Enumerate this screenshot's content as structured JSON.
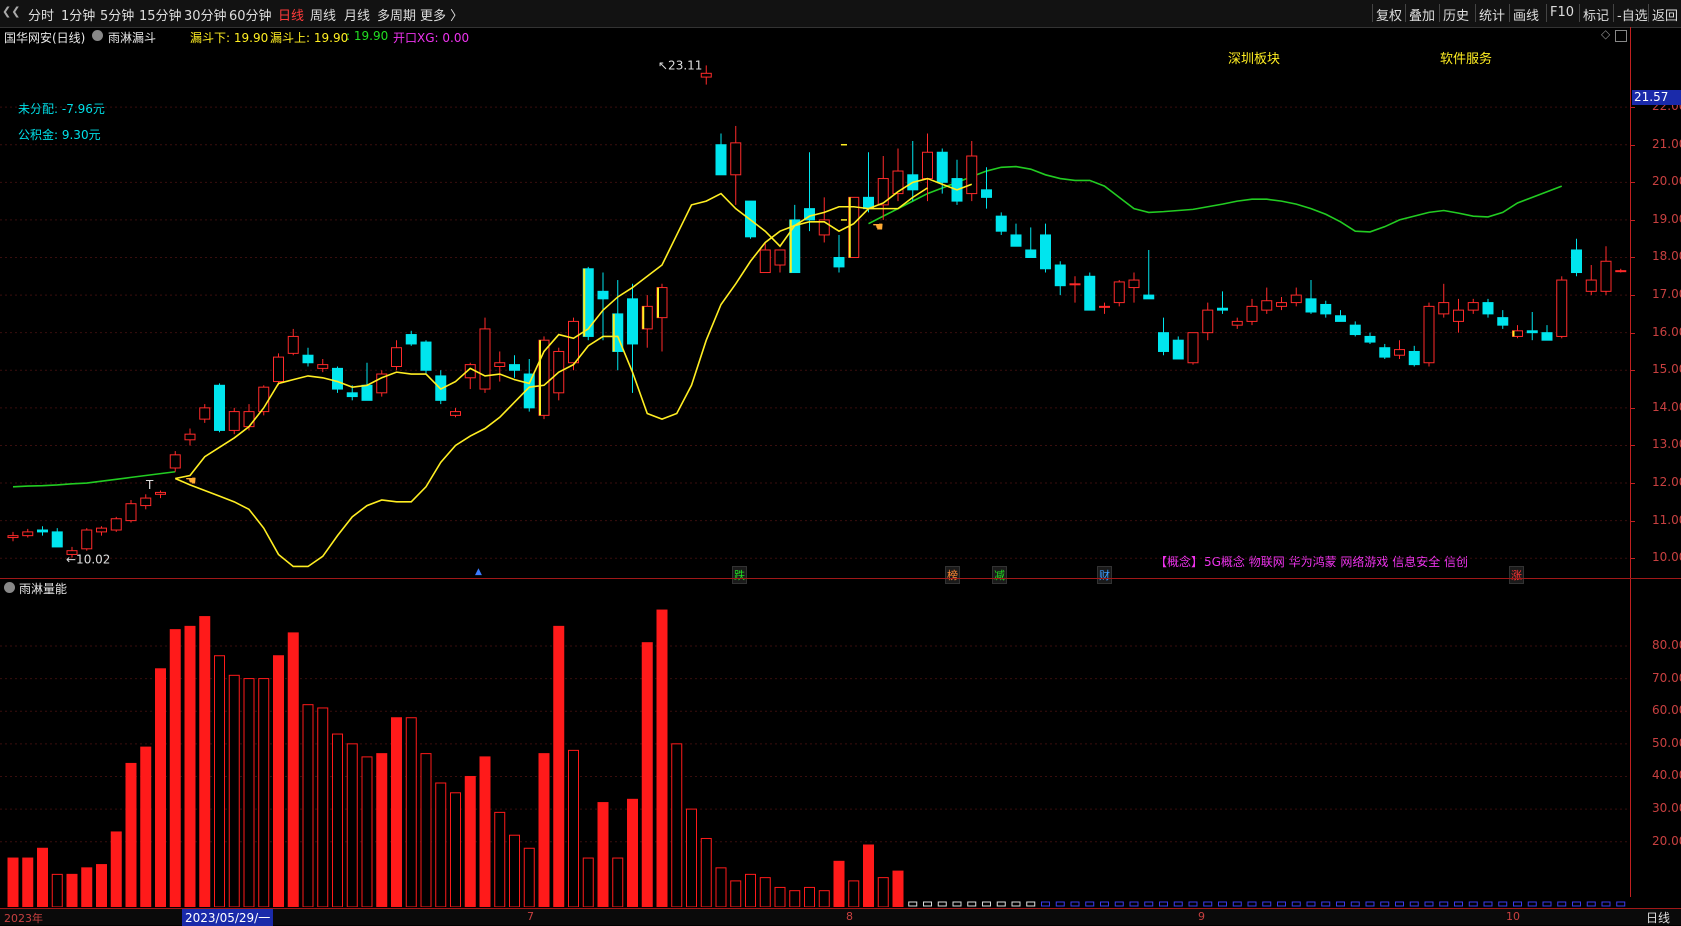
{
  "toolbar": {
    "periods": [
      "分时",
      "1分钟",
      "5分钟",
      "15分钟",
      "30分钟",
      "60分钟",
      "日线",
      "周线",
      "月线",
      "多周期",
      "更多 〉"
    ],
    "active": "日线",
    "right": [
      "复权",
      "叠加",
      "历史",
      "统计",
      "画线",
      "F10",
      "标记",
      "-自选",
      "返回"
    ]
  },
  "info": {
    "stock": "国华网安(日线)",
    "indicator": "雨淋漏斗",
    "f1": "漏斗下: 19.90",
    "f2": "漏斗上: 19.90",
    "f3": ": 19.90",
    "f4": "开口XG: 0.00"
  },
  "overlay": {
    "unallocated": "未分配: -7.96元",
    "reserve": "公积金: 9.30元",
    "sector1": "深圳板块",
    "sector2": "软件服务",
    "high_label": "23.11",
    "low_label": "10.02",
    "concept_prefix": "【概念】",
    "concept_list": "5G概念 物联网 华为鸿蒙 网络游戏 信息安全 信创",
    "markers": [
      "跌",
      "榜",
      "减",
      "财",
      "涨"
    ]
  },
  "price_axis": {
    "current": "21.57",
    "ticks": [
      "22.00",
      "21.00",
      "20.00",
      "19.00",
      "18.00",
      "17.00",
      "16.00",
      "15.00",
      "14.00",
      "13.00",
      "12.00",
      "11.00",
      "10.00"
    ]
  },
  "volume_panel": {
    "title": "雨淋量能",
    "ticks": [
      "80.00",
      "70.00",
      "60.00",
      "50.00",
      "40.00",
      "30.00",
      "20.00"
    ]
  },
  "date_axis": {
    "labels": [
      "2023年",
      "2023/05/29/一",
      "7",
      "8",
      "9",
      "10"
    ],
    "period": "日线"
  },
  "colors": {
    "up": "#ff2a2a",
    "down": "#00e5ee",
    "ma_yellow": "#ffee22",
    "ma_green": "#22cc22"
  },
  "chart_data": {
    "type": "candlestick",
    "candles": [
      [
        10.55,
        10.7,
        10.45,
        10.6
      ],
      [
        10.6,
        10.78,
        10.55,
        10.7
      ],
      [
        10.75,
        10.85,
        10.6,
        10.7
      ],
      [
        10.7,
        10.8,
        10.3,
        10.3
      ],
      [
        10.1,
        10.3,
        10.02,
        10.2
      ],
      [
        10.25,
        10.8,
        10.2,
        10.75
      ],
      [
        10.7,
        10.85,
        10.6,
        10.8
      ],
      [
        10.75,
        11.1,
        10.7,
        11.05
      ],
      [
        11.0,
        11.55,
        10.95,
        11.45
      ],
      [
        11.4,
        11.7,
        11.3,
        11.6
      ],
      [
        11.7,
        11.8,
        11.6,
        11.75
      ],
      [
        12.4,
        12.85,
        12.3,
        12.75
      ],
      [
        13.15,
        13.45,
        13.0,
        13.3
      ],
      [
        13.7,
        14.1,
        13.6,
        14.0
      ],
      [
        14.6,
        14.65,
        13.35,
        13.4
      ],
      [
        13.4,
        14.0,
        13.3,
        13.9
      ],
      [
        13.5,
        14.1,
        13.4,
        13.9
      ],
      [
        13.9,
        14.6,
        13.8,
        14.55
      ],
      [
        14.7,
        15.45,
        14.6,
        15.35
      ],
      [
        15.45,
        16.1,
        15.4,
        15.9
      ],
      [
        15.4,
        15.6,
        15.1,
        15.2
      ],
      [
        15.05,
        15.3,
        14.95,
        15.15
      ],
      [
        15.05,
        15.1,
        14.4,
        14.5
      ],
      [
        14.4,
        14.6,
        14.2,
        14.3
      ],
      [
        14.6,
        15.2,
        14.2,
        14.2
      ],
      [
        14.4,
        15.0,
        14.3,
        14.9
      ],
      [
        15.1,
        15.8,
        15.0,
        15.6
      ],
      [
        15.95,
        16.05,
        15.65,
        15.7
      ],
      [
        15.75,
        15.8,
        14.9,
        15.0
      ],
      [
        14.85,
        15.0,
        14.1,
        14.2
      ],
      [
        13.8,
        14.0,
        13.75,
        13.9
      ],
      [
        14.8,
        15.2,
        14.5,
        15.15
      ],
      [
        14.5,
        16.4,
        14.4,
        16.1
      ],
      [
        15.1,
        15.5,
        14.7,
        15.2
      ],
      [
        15.15,
        15.4,
        14.8,
        15.0
      ],
      [
        14.9,
        15.3,
        13.9,
        14.0
      ],
      [
        13.8,
        15.9,
        13.7,
        15.8
      ],
      [
        14.4,
        15.6,
        14.2,
        15.5
      ],
      [
        15.2,
        16.4,
        15.0,
        16.3
      ],
      [
        17.7,
        17.75,
        15.8,
        15.9
      ],
      [
        17.1,
        17.6,
        15.8,
        16.9
      ],
      [
        16.5,
        17.4,
        15.0,
        15.5
      ],
      [
        16.9,
        17.3,
        14.4,
        15.7
      ],
      [
        16.1,
        17.0,
        15.6,
        16.7
      ],
      [
        16.4,
        17.3,
        15.5,
        17.2
      ],
      [
        null,
        null,
        null,
        null
      ],
      [
        null,
        null,
        null,
        null
      ],
      [
        22.8,
        23.11,
        22.6,
        22.9
      ],
      [
        21.0,
        21.3,
        20.2,
        20.2
      ],
      [
        20.2,
        21.5,
        19.4,
        21.05
      ],
      [
        19.5,
        19.5,
        18.5,
        18.55
      ],
      [
        17.6,
        18.4,
        17.6,
        18.2
      ],
      [
        17.8,
        18.2,
        17.6,
        18.2
      ],
      [
        19.0,
        19.4,
        17.6,
        17.6
      ],
      [
        19.3,
        20.8,
        18.7,
        19.0
      ],
      [
        18.6,
        19.6,
        18.4,
        19.0
      ],
      [
        18.0,
        18.6,
        17.6,
        17.75
      ],
      [
        18.0,
        19.6,
        18.0,
        19.6
      ],
      [
        19.6,
        20.8,
        19.2,
        19.3
      ],
      [
        19.4,
        20.7,
        19.0,
        20.1
      ],
      [
        19.7,
        20.9,
        19.5,
        20.3
      ],
      [
        20.2,
        21.1,
        19.5,
        19.8
      ],
      [
        20.1,
        21.3,
        19.5,
        20.8
      ],
      [
        20.8,
        20.9,
        19.7,
        20.0
      ],
      [
        20.1,
        20.6,
        19.4,
        19.5
      ],
      [
        19.7,
        21.1,
        19.5,
        20.7
      ],
      [
        19.8,
        20.4,
        19.3,
        19.6
      ],
      [
        19.1,
        19.2,
        18.6,
        18.7
      ],
      [
        18.6,
        18.9,
        18.3,
        18.3
      ],
      [
        18.2,
        18.8,
        18.0,
        18.0
      ],
      [
        18.6,
        18.9,
        17.6,
        17.7
      ],
      [
        17.8,
        17.9,
        17.0,
        17.25
      ],
      [
        17.3,
        17.5,
        16.8,
        17.3
      ],
      [
        17.5,
        17.6,
        16.6,
        16.6
      ],
      [
        16.7,
        16.8,
        16.5,
        16.7
      ],
      [
        16.8,
        17.4,
        16.7,
        17.35
      ],
      [
        17.2,
        17.6,
        16.8,
        17.4
      ],
      [
        17.0,
        18.2,
        16.9,
        16.9
      ],
      [
        16.0,
        16.4,
        15.4,
        15.5
      ],
      [
        15.8,
        15.9,
        15.3,
        15.3
      ],
      [
        15.2,
        16.0,
        15.15,
        16.0
      ],
      [
        16.0,
        16.8,
        15.8,
        16.6
      ],
      [
        16.65,
        17.1,
        16.5,
        16.6
      ],
      [
        16.2,
        16.4,
        16.1,
        16.3
      ],
      [
        16.3,
        16.9,
        16.2,
        16.7
      ],
      [
        16.6,
        17.2,
        16.5,
        16.85
      ],
      [
        16.7,
        16.95,
        16.6,
        16.8
      ],
      [
        16.8,
        17.2,
        16.7,
        17.0
      ],
      [
        16.9,
        17.4,
        16.5,
        16.55
      ],
      [
        16.75,
        16.85,
        16.4,
        16.5
      ],
      [
        16.45,
        16.6,
        16.3,
        16.3
      ],
      [
        16.2,
        16.3,
        15.9,
        15.95
      ],
      [
        15.9,
        16.0,
        15.7,
        15.75
      ],
      [
        15.6,
        15.7,
        15.3,
        15.35
      ],
      [
        15.4,
        15.8,
        15.3,
        15.55
      ],
      [
        15.5,
        15.65,
        15.1,
        15.15
      ],
      [
        15.2,
        16.8,
        15.1,
        16.7
      ],
      [
        16.5,
        17.3,
        16.4,
        16.8
      ],
      [
        16.3,
        16.9,
        16.0,
        16.6
      ],
      [
        16.6,
        16.9,
        16.5,
        16.8
      ],
      [
        16.8,
        16.9,
        16.4,
        16.5
      ],
      [
        16.4,
        16.6,
        16.1,
        16.2
      ],
      [
        15.9,
        16.2,
        15.85,
        16.05
      ],
      [
        16.05,
        16.55,
        15.8,
        16.0
      ],
      [
        16.0,
        16.2,
        15.8,
        15.8
      ],
      [
        15.9,
        17.5,
        15.85,
        17.4
      ],
      [
        18.2,
        18.5,
        17.5,
        17.6
      ],
      [
        17.1,
        17.8,
        17.0,
        17.4
      ],
      [
        17.1,
        18.3,
        17.0,
        17.9
      ],
      [
        17.65,
        17.7,
        17.6,
        17.65
      ]
    ],
    "yellow_upper": [
      null,
      null,
      null,
      null,
      null,
      null,
      null,
      null,
      null,
      null,
      null,
      12.12,
      12.2,
      12.7,
      12.95,
      13.2,
      13.5,
      14.0,
      14.65,
      14.75,
      14.85,
      14.8,
      14.7,
      14.55,
      14.6,
      14.8,
      14.95,
      14.9,
      14.9,
      14.5,
      14.7,
      15.05,
      14.85,
      14.9,
      14.75,
      14.65,
      15.5,
      15.95,
      15.85,
      16.1,
      16.6,
      16.95,
      17.2,
      17.5,
      17.8,
      18.6,
      19.4,
      19.5,
      19.7,
      19.3,
      19.0,
      18.7,
      18.3,
      18.85,
      18.95,
      18.95,
      18.7,
      18.9,
      19.3,
      19.45,
      19.75,
      20.0,
      20.1,
      19.95,
      19.8,
      19.95
    ],
    "yellow_lower": [
      null,
      null,
      null,
      null,
      null,
      null,
      null,
      null,
      null,
      null,
      null,
      12.12,
      11.95,
      11.8,
      11.65,
      11.5,
      11.3,
      10.8,
      10.1,
      9.78,
      9.78,
      10.05,
      10.6,
      11.1,
      11.4,
      11.55,
      11.5,
      11.5,
      11.9,
      12.55,
      13.0,
      13.25,
      13.45,
      13.75,
      14.15,
      14.55,
      14.6,
      14.95,
      15.15,
      15.65,
      15.9,
      15.9,
      14.95,
      13.85,
      13.7,
      13.85,
      14.6,
      15.8,
      16.75,
      17.3,
      17.9,
      18.4,
      18.7,
      18.85,
      19.1,
      19.2,
      19.35,
      19.35,
      19.3,
      19.3,
      19.3,
      19.6,
      19.85
    ],
    "green_line": [
      11.9,
      11.92,
      11.93,
      11.95,
      11.98,
      12.0,
      12.05,
      12.1,
      12.15,
      12.2,
      12.25,
      12.3,
      null,
      null,
      null,
      null,
      null,
      null,
      null,
      null,
      null,
      null,
      null,
      null,
      null,
      null,
      null,
      null,
      null,
      null,
      null,
      null,
      null,
      null,
      null,
      null,
      null,
      null,
      null,
      null,
      null,
      null,
      null,
      null,
      null,
      null,
      null,
      null,
      null,
      null,
      null,
      null,
      null,
      null,
      null,
      null,
      null,
      null,
      18.9,
      19.1,
      19.3,
      19.5,
      19.7,
      19.85,
      20.0,
      20.15,
      20.3,
      20.4,
      20.42,
      20.35,
      20.2,
      20.1,
      20.05,
      20.05,
      19.9,
      19.6,
      19.3,
      19.2,
      19.22,
      19.25,
      19.28,
      19.35,
      19.42,
      19.5,
      19.55,
      19.55,
      19.5,
      19.42,
      19.3,
      19.15,
      18.95,
      18.7,
      18.68,
      18.82,
      19.0,
      19.1,
      19.2,
      19.25,
      19.18,
      19.1,
      19.08,
      19.2,
      19.45,
      19.6,
      19.75,
      19.9
    ],
    "volume": [
      15,
      15,
      18,
      10,
      10,
      12,
      13,
      23,
      44,
      49,
      73,
      85,
      86,
      89,
      77,
      71,
      70,
      70,
      77,
      84,
      62,
      61,
      53,
      50,
      46,
      47,
      58,
      58,
      47,
      38,
      35,
      40,
      46,
      29,
      22,
      18,
      47,
      86,
      48,
      15,
      32,
      15,
      33,
      81,
      91,
      50,
      30,
      21,
      12,
      8,
      10,
      9,
      6,
      5,
      6,
      5,
      14,
      8,
      19,
      9,
      11,
      1,
      1,
      1,
      1,
      1,
      1,
      1,
      1,
      1,
      1,
      1,
      1,
      1,
      1,
      1,
      1,
      1,
      1,
      1,
      1,
      1,
      1,
      1,
      1,
      1,
      1,
      1,
      1,
      1,
      1,
      1,
      1,
      1,
      1,
      1,
      1,
      1,
      1,
      1,
      1,
      1,
      1,
      1,
      1,
      1,
      1,
      1,
      1,
      1,
      1,
      1,
      1,
      5,
      5,
      4,
      10,
      5
    ],
    "volume_filled": [
      1,
      1,
      1,
      0,
      1,
      1,
      1,
      1,
      1,
      1,
      1,
      1,
      1,
      1,
      0,
      0,
      0,
      0,
      1,
      1,
      0,
      0,
      0,
      0,
      0,
      1,
      1,
      0,
      0,
      0,
      0,
      1,
      1,
      0,
      0,
      0,
      1,
      1,
      0,
      0,
      1,
      0,
      1,
      1,
      1,
      0,
      0,
      0,
      0,
      0,
      0,
      0,
      0,
      0,
      0,
      0,
      1,
      0,
      1,
      0,
      1,
      0,
      0,
      0,
      0,
      0,
      0,
      0,
      0,
      0,
      0,
      0,
      0,
      0,
      0,
      0,
      0,
      0,
      0,
      0,
      0,
      0,
      0,
      0,
      0,
      0,
      0,
      0,
      0,
      0,
      0,
      0,
      0,
      0,
      0,
      0,
      0,
      0,
      0,
      0,
      0,
      0,
      0,
      0,
      0,
      0,
      0,
      0,
      0,
      0,
      0,
      0,
      0,
      1,
      1,
      0,
      1,
      0
    ],
    "ylim_price": [
      9.5,
      23.6
    ],
    "ylim_volume": [
      0,
      95
    ]
  }
}
